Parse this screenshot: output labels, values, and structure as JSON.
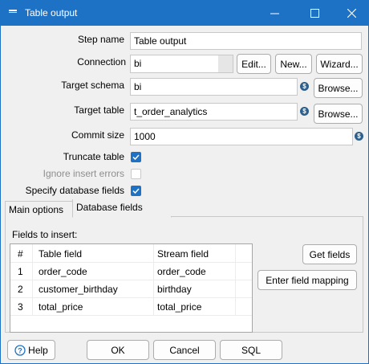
{
  "window": {
    "title": "Table output"
  },
  "form": {
    "step_name": {
      "label": "Step name",
      "value": "Table output"
    },
    "connection": {
      "label": "Connection",
      "value": "bi",
      "edit_label": "Edit...",
      "new_label": "New...",
      "wizard_label": "Wizard..."
    },
    "target_schema": {
      "label": "Target schema",
      "value": "bi",
      "browse_label": "Browse..."
    },
    "target_table": {
      "label": "Target table",
      "value": "t_order_analytics",
      "browse_label": "Browse..."
    },
    "commit_size": {
      "label": "Commit size",
      "value": "1000"
    },
    "truncate_table": {
      "label": "Truncate table",
      "checked": true
    },
    "ignore_insert_errors": {
      "label": "Ignore insert errors",
      "checked": false,
      "disabled": true
    },
    "specify_db_fields": {
      "label": "Specify database fields",
      "checked": true
    }
  },
  "tabs": [
    {
      "label": "Main options",
      "active": false
    },
    {
      "label": "Database fields",
      "active": true
    }
  ],
  "db_fields": {
    "section_label": "Fields to insert:",
    "columns": [
      "#",
      "Table field",
      "Stream field"
    ],
    "rows": [
      [
        "1",
        "order_code",
        "order_code"
      ],
      [
        "2",
        "customer_birthday",
        "birthday"
      ],
      [
        "3",
        "total_price",
        "total_price"
      ]
    ],
    "get_fields_label": "Get fields",
    "enter_mapping_label": "Enter field mapping"
  },
  "footer": {
    "help_label": "Help",
    "ok_label": "OK",
    "cancel_label": "Cancel",
    "sql_label": "SQL"
  },
  "colors": {
    "titlebar": "#1e72c6",
    "checkbox_checked": "#1e72c6",
    "variable_icon": "#2d5f8a"
  }
}
